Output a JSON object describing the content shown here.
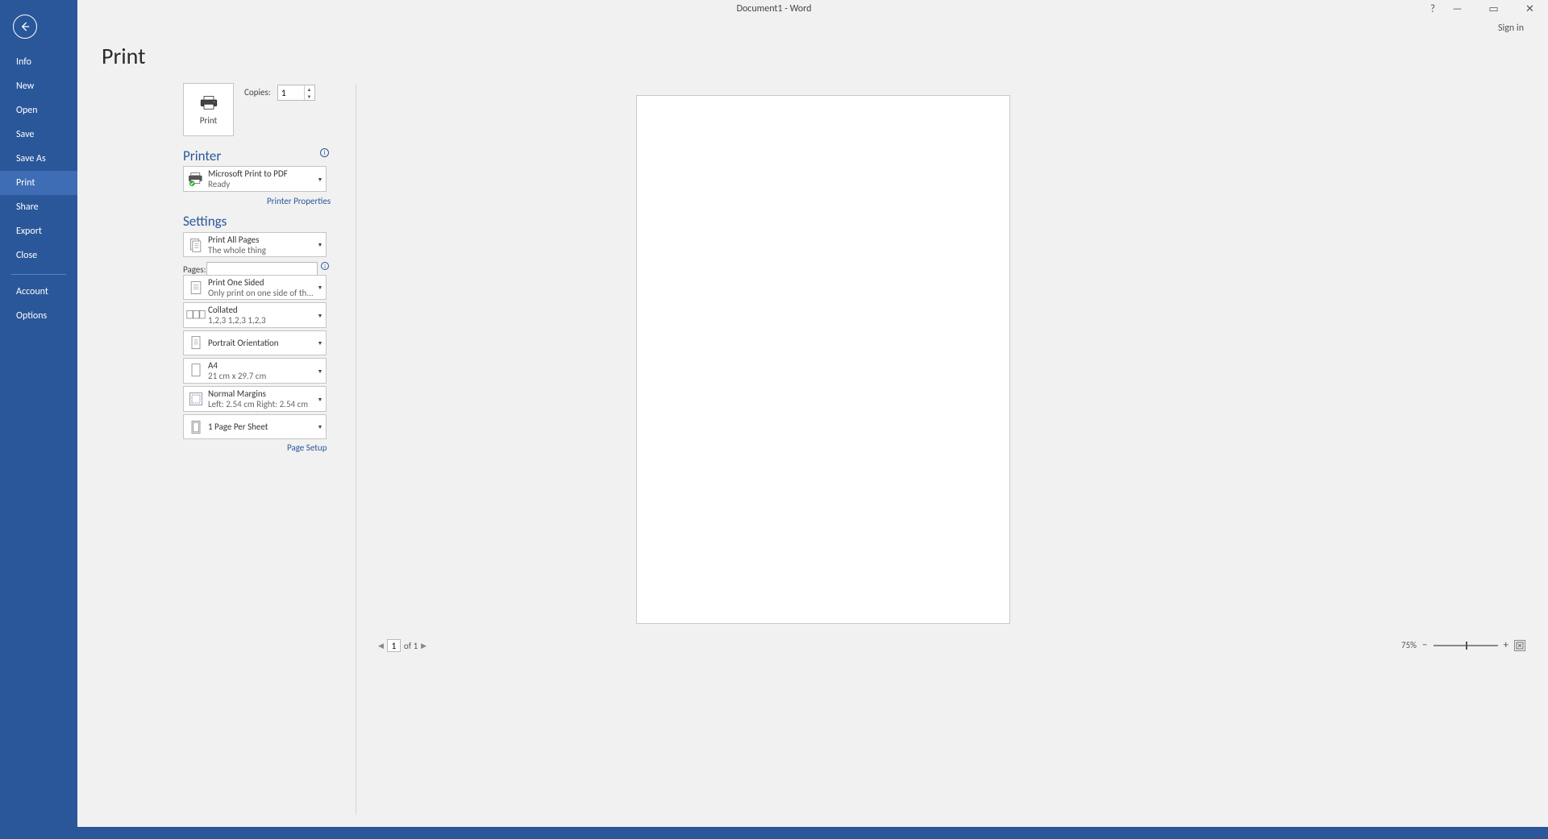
{
  "app": {
    "title": "Document1 - Word",
    "signin": "Sign in"
  },
  "nav": {
    "items": [
      "Info",
      "New",
      "Open",
      "Save",
      "Save As",
      "Print",
      "Share",
      "Export",
      "Close"
    ],
    "active": "Print",
    "footer": [
      "Account",
      "Options"
    ]
  },
  "page": {
    "heading": "Print",
    "print_button": "Print",
    "copies_label": "Copies:",
    "copies_value": "1",
    "printer_section": "Printer",
    "settings_section": "Settings",
    "printer": {
      "name": "Microsoft Print to PDF",
      "status": "Ready",
      "properties": "Printer Properties"
    },
    "settings": {
      "print_all": {
        "line1": "Print All Pages",
        "line2": "The whole thing"
      },
      "pages_label": "Pages:",
      "pages_value": "",
      "side": {
        "line1": "Print One Sided",
        "line2": "Only print on one side of th..."
      },
      "collate": {
        "line1": "Collated",
        "line2": "1,2,3    1,2,3    1,2,3"
      },
      "orient": {
        "line1": "Portrait Orientation"
      },
      "paper": {
        "line1": "A4",
        "line2": "21 cm x 29.7 cm"
      },
      "margins": {
        "line1": "Normal Margins",
        "line2": "Left:  2.54 cm    Right:  2.54 cm"
      },
      "pps": {
        "line1": "1 Page Per Sheet"
      },
      "page_setup": "Page Setup"
    },
    "preview_nav": {
      "current": "1",
      "of": "of 1"
    },
    "zoom": {
      "pct": "75%"
    }
  }
}
